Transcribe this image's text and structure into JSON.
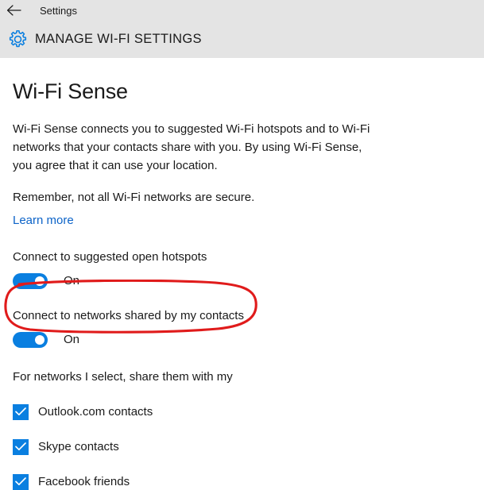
{
  "window": {
    "titlebar_label": "Settings",
    "back_icon": "back-arrow-icon"
  },
  "header": {
    "icon": "gear-icon",
    "title": "MANAGE WI-FI SETTINGS",
    "background_color": "#e4e4e4"
  },
  "page": {
    "title": "Wi-Fi Sense",
    "intro_paragraph": "Wi-Fi Sense connects you to suggested Wi-Fi hotspots and to Wi-Fi networks that your contacts share with you. By using Wi-Fi Sense, you agree that it can use your location.",
    "secure_note": "Remember, not all Wi-Fi networks are secure.",
    "learn_more_label": "Learn more",
    "link_color": "#0c63c8"
  },
  "settings": {
    "hotspots": {
      "label": "Connect to suggested open hotspots",
      "state_label": "On",
      "checked": true
    },
    "contacts": {
      "label": "Connect to networks shared by my contacts",
      "state_label": "On",
      "checked": true,
      "annotated": true
    }
  },
  "sharing": {
    "intro": "For networks I select, share them with my",
    "options": [
      {
        "label": "Outlook.com contacts",
        "checked": true
      },
      {
        "label": "Skype contacts",
        "checked": true
      },
      {
        "label": "Facebook friends",
        "checked": true
      }
    ]
  },
  "annotation": {
    "shape": "ellipse",
    "color": "#e01b1b",
    "target": "Connect to networks shared by my contacts"
  },
  "theme": {
    "accent_color": "#0a7fe0",
    "text_color": "#1a1a1a",
    "page_background": "#ffffff"
  }
}
